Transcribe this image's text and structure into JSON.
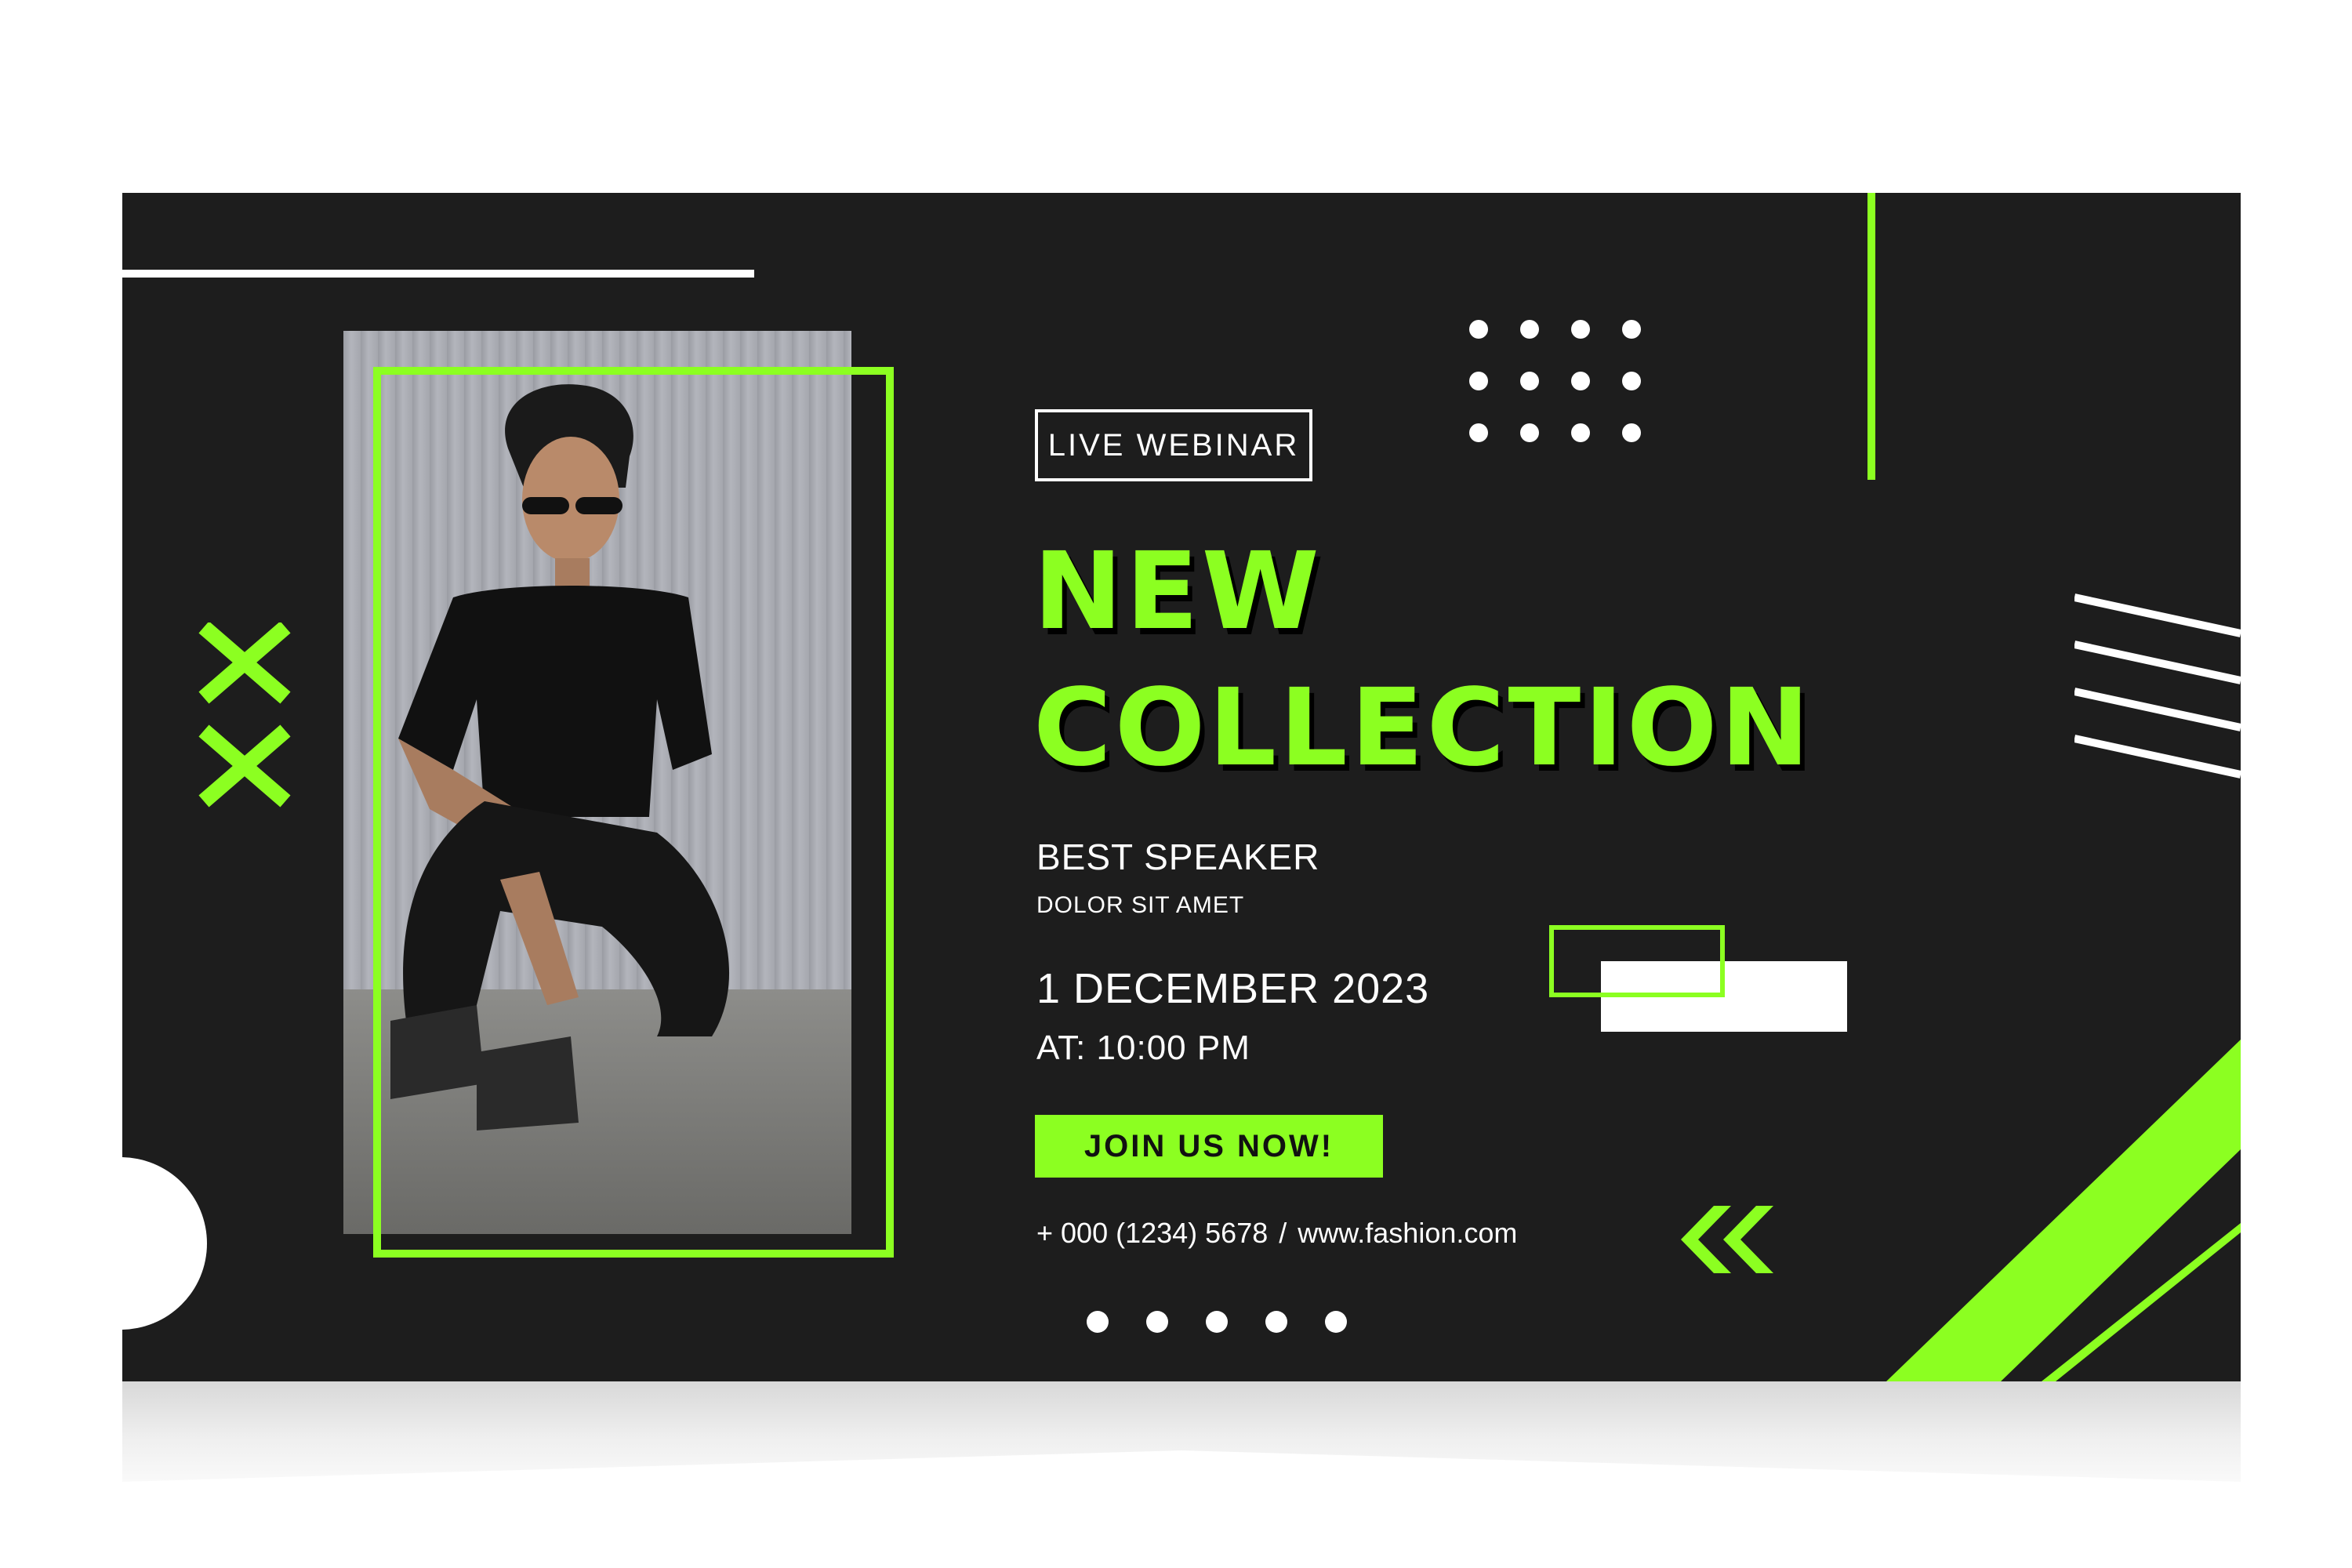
{
  "colors": {
    "accent": "#8cff21",
    "background": "#1d1d1d",
    "text": "#ffffff"
  },
  "badge": "LIVE WEBINAR",
  "headline": {
    "line1": "NEW",
    "line2": "COLLECTION"
  },
  "speaker": {
    "title": "BEST SPEAKER",
    "subtitle": "DOLOR SIT AMET"
  },
  "event": {
    "date": "1 DECEMBER 2023",
    "time": "AT: 10:00 PM"
  },
  "cta": "JOIN US NOW!",
  "contact": {
    "phone": "+ 000 (1234) 5678",
    "separator": "/",
    "website": "www.fashion.com"
  },
  "icons": [
    "x-mark-icon",
    "double-chevron-left-icon",
    "dot-grid-icon"
  ]
}
